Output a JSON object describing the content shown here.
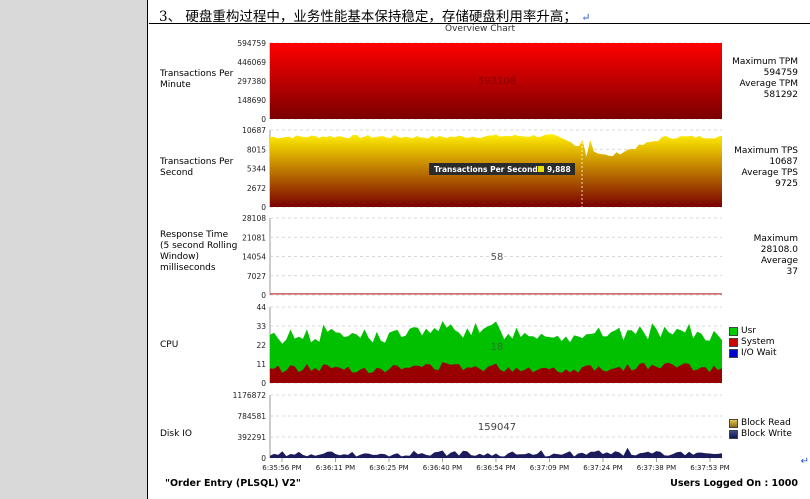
{
  "document": {
    "step_number": "3、",
    "step_text": "硬盘重构过程中，业务性能基本保持稳定，存储硬盘利用率升高；",
    "return_mark": "↵"
  },
  "chart": {
    "title": "Overview Chart",
    "footer_left": "\"Order Entry (PLSQL) V2\"",
    "footer_right": "Users Logged On : 1000",
    "footer_mark": "↵",
    "x_ticks": [
      "6:35:56 PM",
      "6:36:11 PM",
      "6:36:25 PM",
      "6:36:40 PM",
      "6:36:54 PM",
      "6:37:09 PM",
      "6:37:24 PM",
      "6:37:38 PM",
      "6:37:53 PM"
    ],
    "panels": [
      {
        "key": "tpm",
        "title": "Transactions Per Minute",
        "y_ticks": [
          "594759",
          "446069",
          "297380",
          "148690",
          "0"
        ],
        "center_value": "593108",
        "stats": [
          "Maximum TPM",
          "594759",
          "Average TPM",
          "581292"
        ],
        "colors": {
          "top": "#ff0000",
          "bottom": "#7a0000"
        }
      },
      {
        "key": "tps",
        "title": "Transactions Per Second",
        "y_ticks": [
          "10687",
          "8015",
          "5344",
          "2672",
          "0"
        ],
        "tooltip_label": "Transactions Per Second",
        "tooltip_value": "9,888",
        "stats": [
          "Maximum TPS",
          "10687",
          "Average TPS",
          "9725"
        ],
        "colors": {
          "top": "#ffee00",
          "bottom": "#7a0000"
        }
      },
      {
        "key": "rt",
        "title": "Response Time (5 second Rolling Window) milliseconds",
        "y_ticks": [
          "28108",
          "21081",
          "14054",
          "7027",
          "0"
        ],
        "center_value": "58",
        "stats": [
          "Maximum",
          "28108.0",
          "Average",
          "37"
        ]
      },
      {
        "key": "cpu",
        "title": "CPU",
        "y_ticks": [
          "44",
          "33",
          "22",
          "11",
          "0"
        ],
        "center_value": "18",
        "legend": [
          {
            "label": "Usr",
            "color": "#00cc00"
          },
          {
            "label": "System",
            "color": "#cc0000"
          },
          {
            "label": "I/O Wait",
            "color": "#0000cc"
          }
        ]
      },
      {
        "key": "disk",
        "title": "Disk IO",
        "y_ticks": [
          "1176872",
          "784581",
          "392291",
          "0"
        ],
        "center_value": "159047",
        "legend": [
          {
            "label": "Block Read",
            "color": "#e8c84a"
          },
          {
            "label": "Block Write",
            "color": "#1a2a6c"
          }
        ]
      }
    ]
  },
  "chart_data": [
    {
      "type": "area",
      "y_range": [
        0,
        594759
      ],
      "series": [
        {
          "values": [
            594759,
            594759,
            594759,
            594759,
            594759,
            594759,
            594759,
            594759,
            594759
          ]
        }
      ]
    },
    {
      "type": "area",
      "y_range": [
        0,
        10687
      ],
      "series": [
        {
          "values": [
            9700,
            9800,
            9750,
            9700,
            9850,
            9888,
            7000,
            9700,
            9750
          ]
        }
      ]
    },
    {
      "type": "line",
      "y_range": [
        0,
        28108
      ],
      "series": [
        {
          "values": [
            37,
            37,
            37,
            37,
            37,
            37,
            37,
            37,
            37
          ]
        }
      ]
    },
    {
      "type": "area",
      "y_range": [
        0,
        44
      ],
      "series": [
        {
          "name": "Usr",
          "values": [
            18,
            20,
            19,
            21,
            22,
            20,
            19,
            21,
            18
          ]
        },
        {
          "name": "System",
          "values": [
            8,
            9,
            8,
            10,
            9,
            8,
            9,
            10,
            8
          ]
        },
        {
          "name": "I/O Wait",
          "values": [
            0,
            0,
            0,
            0,
            0,
            0,
            0,
            0,
            0
          ]
        }
      ]
    },
    {
      "type": "area",
      "y_range": [
        0,
        1176872
      ],
      "series": [
        {
          "name": "Block Read",
          "values": [
            0,
            0,
            0,
            0,
            0,
            0,
            0,
            0,
            0
          ]
        },
        {
          "name": "Block Write",
          "values": [
            50000,
            80000,
            60000,
            90000,
            70000,
            60000,
            80000,
            75000,
            65000
          ]
        }
      ]
    }
  ]
}
